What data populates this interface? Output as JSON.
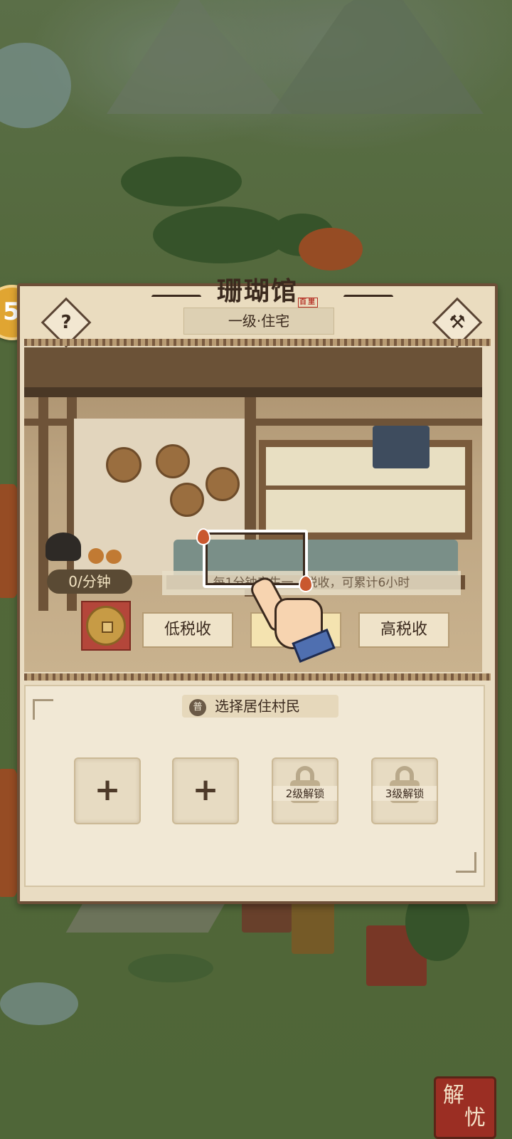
{
  "building": {
    "title": "珊瑚馆",
    "seal": "百里",
    "level_type": "一级·住宅"
  },
  "header": {
    "help_icon": "question-icon",
    "build_icon": "hammer-icon",
    "help_glyph": "?",
    "build_glyph": "⚒"
  },
  "tax": {
    "rate": "0/分钟",
    "hint": "每1分钟产生一…税收，可累计6小时",
    "coin_icon": "copper-coin-icon",
    "options": [
      {
        "label": "低税收"
      },
      {
        "label": "中"
      },
      {
        "label": "高税收"
      }
    ]
  },
  "residents": {
    "header_icon_glyph": "普",
    "header_label": "选择居住村民",
    "slots": [
      {
        "type": "add",
        "glyph": "+"
      },
      {
        "type": "add",
        "glyph": "+"
      },
      {
        "type": "locked",
        "label": "2级解锁"
      },
      {
        "type": "locked",
        "label": "3级解锁"
      }
    ]
  },
  "side_button_glyph": "5",
  "corner_badge": {
    "char1": "解",
    "char2": "忧"
  },
  "colors": {
    "panel_bg": "#e9dcc2",
    "panel_border": "#6d4f38",
    "text_dark": "#3b2a1e",
    "coin_box_red": "#b4463a",
    "badge_red": "#9b2e23"
  }
}
